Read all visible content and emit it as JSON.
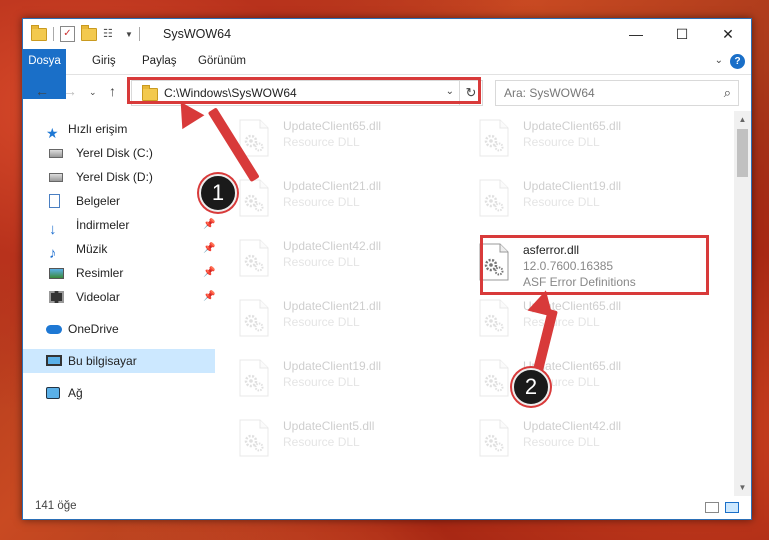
{
  "window": {
    "title": "SysWOW64",
    "minimize": "—",
    "maximize": "☐",
    "close": "✕"
  },
  "ribbon": {
    "tabs": [
      "Dosya",
      "Giriş",
      "Paylaş",
      "Görünüm"
    ],
    "help": "?"
  },
  "nav": {
    "address": "C:\\Windows\\SysWOW64",
    "search_placeholder": "Ara: SysWOW64"
  },
  "sidebar": {
    "quick_access": "Hızlı erişim",
    "items": [
      {
        "label": "Yerel Disk (C:)",
        "icon": "disk-icon",
        "pinned": false
      },
      {
        "label": "Yerel Disk (D:)",
        "icon": "disk-icon",
        "pinned": false
      },
      {
        "label": "Belgeler",
        "icon": "documents-icon",
        "pinned": true
      },
      {
        "label": "İndirmeler",
        "icon": "downloads-icon",
        "pinned": true
      },
      {
        "label": "Müzik",
        "icon": "music-icon",
        "pinned": true
      },
      {
        "label": "Resimler",
        "icon": "pictures-icon",
        "pinned": true
      },
      {
        "label": "Videolar",
        "icon": "videos-icon",
        "pinned": true
      }
    ],
    "onedrive": "OneDrive",
    "this_pc": "Bu bilgisayar",
    "network": "Ağ"
  },
  "files": [
    {
      "name": "UpdateClient65.dll",
      "sub": "Resource DLL",
      "col": 0,
      "row": 0,
      "faded": true
    },
    {
      "name": "UpdateClient65.dll",
      "sub": "Resource DLL",
      "col": 1,
      "row": 0,
      "faded": true
    },
    {
      "name": "UpdateClient21.dll",
      "sub": "Resource DLL",
      "col": 0,
      "row": 1,
      "faded": true
    },
    {
      "name": "UpdateClient19.dll",
      "sub": "Resource DLL",
      "col": 1,
      "row": 1,
      "faded": true
    },
    {
      "name": "UpdateClient42.dll",
      "sub": "Resource DLL",
      "col": 0,
      "row": 2,
      "faded": true
    },
    {
      "name": "asferror.dll",
      "sub": "12.0.7600.16385",
      "sub2": "ASF Error Definitions",
      "col": 1,
      "row": 2,
      "faded": false
    },
    {
      "name": "UpdateClient21.dll",
      "sub": "Resource DLL",
      "col": 0,
      "row": 3,
      "faded": true
    },
    {
      "name": "UpdateClient65.dll",
      "sub": "Resource DLL",
      "col": 1,
      "row": 3,
      "faded": true
    },
    {
      "name": "UpdateClient19.dll",
      "sub": "Resource DLL",
      "col": 0,
      "row": 4,
      "faded": true
    },
    {
      "name": "UpdateClient65.dll",
      "sub": "Resource DLL",
      "col": 1,
      "row": 4,
      "faded": true
    },
    {
      "name": "UpdateClient5.dll",
      "sub": "Resource DLL",
      "col": 0,
      "row": 5,
      "faded": true
    },
    {
      "name": "UpdateClient42.dll",
      "sub": "Resource DLL",
      "col": 1,
      "row": 5,
      "faded": true
    }
  ],
  "status": {
    "count": "141 öğe"
  },
  "callouts": [
    "1",
    "2"
  ],
  "colors": {
    "accent": "#1a6fc8",
    "highlight": "#d83a3a",
    "selection": "#cce8ff"
  }
}
